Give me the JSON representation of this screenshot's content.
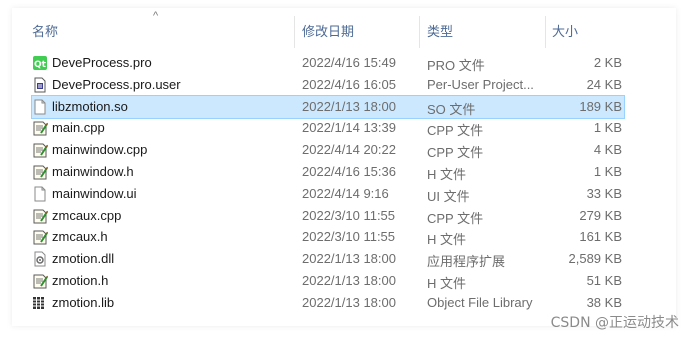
{
  "header": {
    "sort_arrow": "^",
    "col_name": "名称",
    "col_date": "修改日期",
    "col_type": "类型",
    "col_size": "大小"
  },
  "files": [
    {
      "name": "DeveProcess.pro",
      "date": "2022/4/16 15:49",
      "type": "PRO 文件",
      "size": "2 KB",
      "icon": "qt-project-icon",
      "selected": false
    },
    {
      "name": "DeveProcess.pro.user",
      "date": "2022/4/16 16:05",
      "type": "Per-User Project...",
      "size": "24 KB",
      "icon": "project-user-file-icon",
      "selected": false
    },
    {
      "name": "libzmotion.so",
      "date": "2022/1/13 18:00",
      "type": "SO 文件",
      "size": "189 KB",
      "icon": "blank-file-icon",
      "selected": true
    },
    {
      "name": "main.cpp",
      "date": "2022/1/14 13:39",
      "type": "CPP 文件",
      "size": "1 KB",
      "icon": "source-file-icon",
      "selected": false
    },
    {
      "name": "mainwindow.cpp",
      "date": "2022/4/14 20:22",
      "type": "CPP 文件",
      "size": "4 KB",
      "icon": "source-file-icon",
      "selected": false
    },
    {
      "name": "mainwindow.h",
      "date": "2022/4/16 15:36",
      "type": "H 文件",
      "size": "1 KB",
      "icon": "source-file-icon",
      "selected": false
    },
    {
      "name": "mainwindow.ui",
      "date": "2022/4/14 9:16",
      "type": "UI 文件",
      "size": "33 KB",
      "icon": "blank-file-icon",
      "selected": false
    },
    {
      "name": "zmcaux.cpp",
      "date": "2022/3/10 11:55",
      "type": "CPP 文件",
      "size": "279 KB",
      "icon": "source-file-icon",
      "selected": false
    },
    {
      "name": "zmcaux.h",
      "date": "2022/3/10 11:55",
      "type": "H 文件",
      "size": "161 KB",
      "icon": "source-file-icon",
      "selected": false
    },
    {
      "name": "zmotion.dll",
      "date": "2022/1/13 18:00",
      "type": "应用程序扩展",
      "size": "2,589 KB",
      "icon": "dll-file-icon",
      "selected": false
    },
    {
      "name": "zmotion.h",
      "date": "2022/1/13 18:00",
      "type": "H 文件",
      "size": "51 KB",
      "icon": "source-file-icon",
      "selected": false
    },
    {
      "name": "zmotion.lib",
      "date": "2022/1/13 18:00",
      "type": "Object File Library",
      "size": "38 KB",
      "icon": "library-file-icon",
      "selected": false
    }
  ],
  "watermark": "CSDN @正运动技术"
}
